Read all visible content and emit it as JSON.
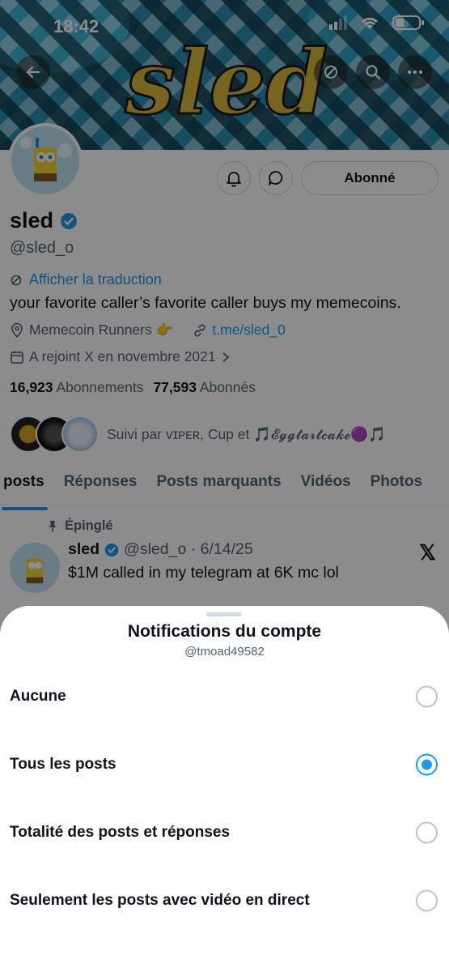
{
  "status": {
    "time": "18:42"
  },
  "banner": {
    "text": "sled"
  },
  "profile": {
    "name": "sled",
    "handle": "@sled_o",
    "translate_label": "Afficher la traduction",
    "bio": "your favorite caller’s favorite caller buys my memecoins.",
    "location": "Memecoin Runners 👉",
    "link": "t.me/sled_0",
    "joined": "A rejoint X en novembre 2021",
    "following_count": "16,923",
    "following_label": "Abonnements",
    "followers_count": "77,593",
    "followers_label": "Abonnés",
    "followed_by": "Suivi par ᴠɪᴘᴇʀ, Cup et 🎵𝓔𝓰𝓰𝓽𝓪𝓻𝓽𝓬𝓪𝓴𝓮🟣🎵",
    "follow_button": "Abonné",
    "verified_color": "#1d9bf0"
  },
  "tabs": [
    "posts",
    "Réponses",
    "Posts marquants",
    "Vidéos",
    "Photos"
  ],
  "pinned_post": {
    "pinned_label": "Épinglé",
    "author": "sled",
    "handle_date": "@sled_o · 6/14/25",
    "text": "$1M called in my telegram at 6K mc lol",
    "logo": "𝕏"
  },
  "sheet": {
    "title": "Notifications du compte",
    "subtitle": "@tmoad49582",
    "options": [
      {
        "label": "Aucune",
        "selected": false
      },
      {
        "label": "Tous les posts",
        "selected": true
      },
      {
        "label": "Totalité des posts et réponses",
        "selected": false
      },
      {
        "label": "Seulement les posts avec vidéo en direct",
        "selected": false
      }
    ]
  },
  "colors": {
    "accent": "#1d9bf0",
    "text": "#0f1419",
    "muted": "#536471"
  }
}
